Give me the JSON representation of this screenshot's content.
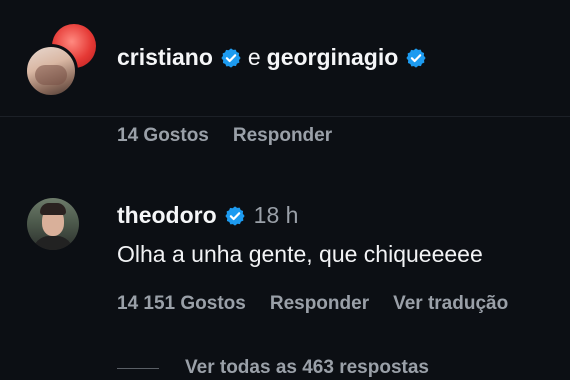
{
  "comment1": {
    "user1": "cristiano",
    "joiner": "e",
    "user2": "georginagio",
    "likes": "14 Gostos",
    "reply": "Responder"
  },
  "comment2": {
    "user": "theodoro",
    "time": "18 h",
    "text": "Olha a unha gente, que chiqueeeee",
    "likes": "14 151 Gostos",
    "reply": "Responder",
    "translate": "Ver tradução",
    "view_replies": "Ver todas as 463 respostas"
  },
  "colors": {
    "background": "#0c0f14",
    "verified": "#1d9bf0",
    "secondary_text": "#9aa0a8"
  },
  "icons": [
    "verified-badge-icon"
  ]
}
